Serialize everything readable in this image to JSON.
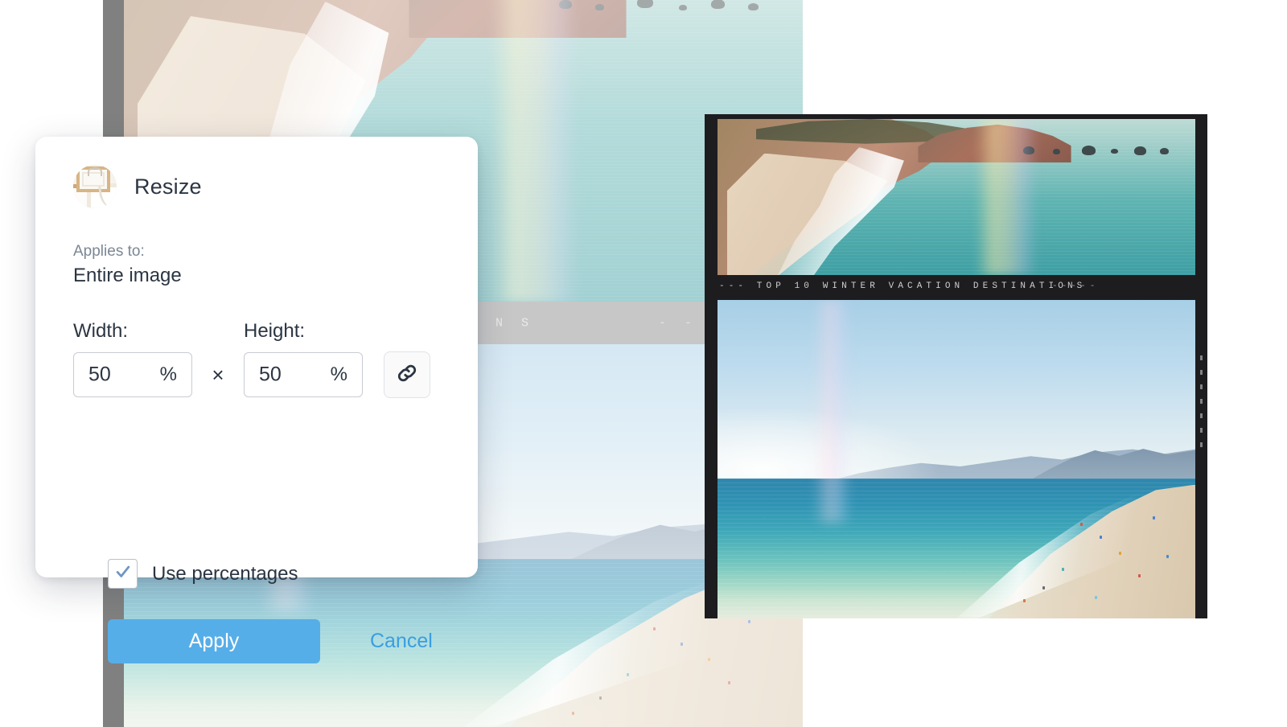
{
  "dialog": {
    "title": "Resize",
    "avatar_icon": "framed-photos-thumbnail-icon",
    "applies_to_label": "Applies to:",
    "applies_to_value": "Entire image",
    "width_label": "Width:",
    "height_label": "Height:",
    "width_value": "50",
    "width_unit": "%",
    "height_value": "50",
    "height_unit": "%",
    "multiply_symbol": "×",
    "link_icon": "chain-link-icon",
    "checkbox_icon": "checkmark-icon",
    "checkbox_label": "Use percentages",
    "checkbox_checked": true,
    "apply_label": "Apply",
    "cancel_label": "Cancel",
    "accent_color": "#56AEE8",
    "link_color": "#3A9EE0",
    "text_color": "#2B3542",
    "muted_text_color": "#7B8795"
  },
  "background_image": {
    "caption_text": "I N A T I O N S",
    "caption_dashes": "- - - - -",
    "border_color": "#808080",
    "caption_bar_color": "#8A8A8A",
    "state": "dimmed"
  },
  "foreground_image": {
    "caption_text": "--- TOP 10 WINTER VACATION DESTINATIONS",
    "caption_dashes": "-----",
    "frame_color": "#1D1D20",
    "state": "active"
  }
}
